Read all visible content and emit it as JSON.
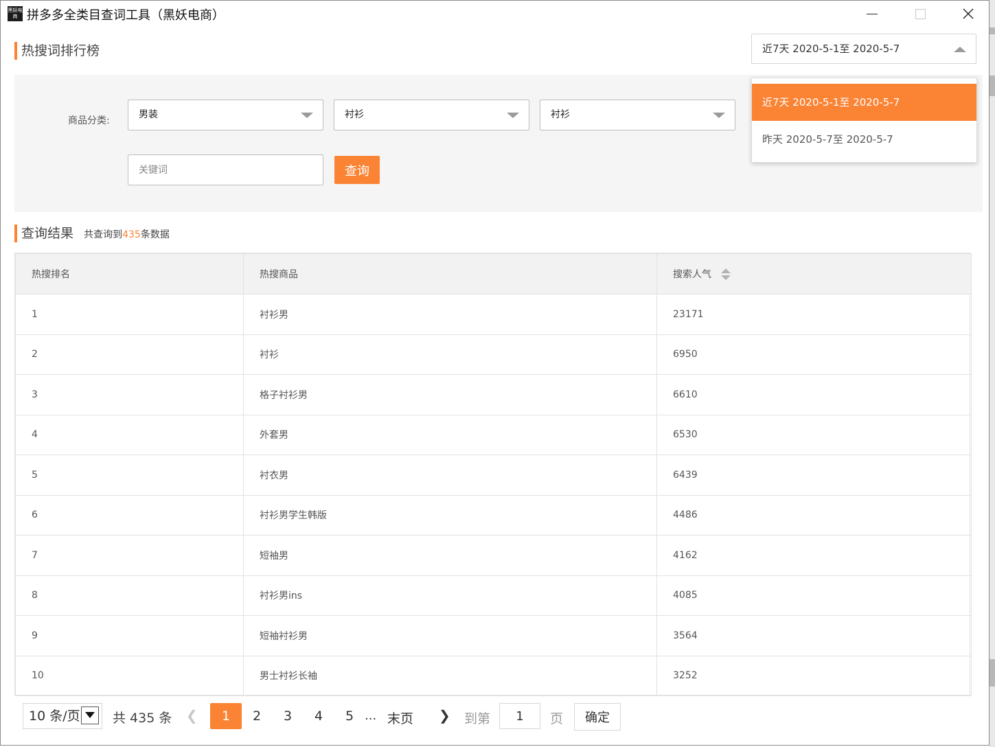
{
  "window": {
    "title": "拼多多全类目查词工具（黑妖电商）",
    "app_icon_text": "黑妖电商",
    "controls": [
      "minimize-icon",
      "maximize-icon",
      "close-icon"
    ]
  },
  "colors": {
    "accent": "#fa8334",
    "panel_bg": "#f5f5f5",
    "header_bg": "#f2f2f2"
  },
  "section_rank": {
    "title": "热搜词排行榜"
  },
  "date_range": {
    "selected": "近7天 2020-5-1至 2020-5-7",
    "options": [
      "近7天 2020-5-1至 2020-5-7",
      "昨天 2020-5-7至 2020-5-7"
    ]
  },
  "filters": {
    "category_label": "商品分类:",
    "category1": "男装",
    "category2": "衬衫",
    "category3": "衬衫",
    "keyword_placeholder": "关键词",
    "query_button": "查询"
  },
  "results": {
    "title": "查询结果",
    "summary_prefix": "共查询到",
    "total": "435",
    "summary_suffix": "条数据"
  },
  "table": {
    "headers": [
      "热搜排名",
      "热搜商品",
      "搜索人气"
    ],
    "rows": [
      [
        "1",
        "衬衫男",
        "23171"
      ],
      [
        "2",
        "衬衫",
        "6950"
      ],
      [
        "3",
        "格子衬衫男",
        "6610"
      ],
      [
        "4",
        "外套男",
        "6530"
      ],
      [
        "5",
        "衬衣男",
        "6439"
      ],
      [
        "6",
        "衬衫男学生韩版",
        "4486"
      ],
      [
        "7",
        "短袖男",
        "4162"
      ],
      [
        "8",
        "衬衫男ins",
        "4085"
      ],
      [
        "9",
        "短袖衬衫男",
        "3564"
      ],
      [
        "10",
        "男士衬衫长袖",
        "3252"
      ]
    ]
  },
  "pagination": {
    "page_size": "10 条/页",
    "total_text": "共 435 条",
    "pages": [
      "1",
      "2",
      "3",
      "4",
      "5"
    ],
    "current_page": "1",
    "ellipsis": "...",
    "last_page": "末页",
    "goto_label": "到第",
    "goto_value": "1",
    "page_unit": "页",
    "confirm": "确定"
  }
}
